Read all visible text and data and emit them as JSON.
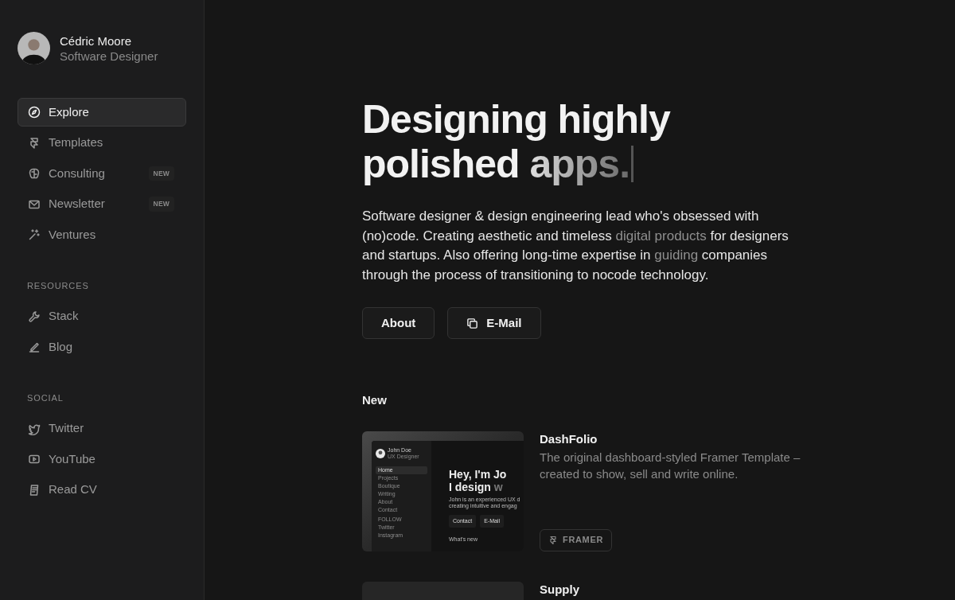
{
  "profile": {
    "name": "Cédric Moore",
    "role": "Software Designer"
  },
  "nav": [
    {
      "label": "Explore",
      "selected": true
    },
    {
      "label": "Templates",
      "selected": false
    },
    {
      "label": "Consulting",
      "selected": false,
      "badge": "NEW"
    },
    {
      "label": "Newsletter",
      "selected": false,
      "badge": "NEW"
    },
    {
      "label": "Ventures",
      "selected": false
    }
  ],
  "sections": [
    {
      "heading": "RESOURCES",
      "items": [
        {
          "label": "Stack"
        },
        {
          "label": "Blog"
        }
      ]
    },
    {
      "heading": "SOCIAL",
      "items": [
        {
          "label": "Twitter"
        },
        {
          "label": "YouTube"
        },
        {
          "label": "Read CV"
        }
      ]
    }
  ],
  "hero": {
    "headline": "Designing highly",
    "headline_2": "polished",
    "highlight": "apps.",
    "intro": {
      "start": "Software designer & design engineering lead who's obsessed with (no)code. Creating aesthetic and timeless ",
      "link_1": "digital products",
      "middle": " for designers and startups. Also offering long-time expertise in ",
      "link_2": "guiding",
      "end": " companies through the process of transitioning to nocode technology."
    },
    "buttons": [
      "About",
      "E-Mail"
    ]
  },
  "new_heading": "New",
  "products": [
    {
      "title": "DashFolio",
      "description": "The original dashboard-styled Framer Template – created to show, sell and write online.",
      "tag": "FRAMER",
      "preview": {
        "name": "John Doe",
        "role": "UX Designer",
        "nav": [
          {
            "label": "Home",
            "selected": true
          },
          {
            "label": "Projects",
            "selected": false
          },
          {
            "label": "Boutique",
            "selected": false
          },
          {
            "label": "Writing",
            "selected": false
          },
          {
            "label": "About",
            "selected": false
          },
          {
            "label": "Contact",
            "selected": false
          }
        ],
        "follow_heading": "FOLLOW",
        "follow": [
          "Twitter",
          "Instagram"
        ],
        "headline": "Hey, I'm Jo",
        "headline_2": "I design",
        "headline_fade": "w",
        "intro": [
          "John is an experienced UX d",
          "creating intuitive and engag"
        ],
        "buttons": [
          "Contact",
          "E-Mail"
        ],
        "whats_new": "What's new"
      }
    },
    {
      "title": "Supply"
    }
  ]
}
